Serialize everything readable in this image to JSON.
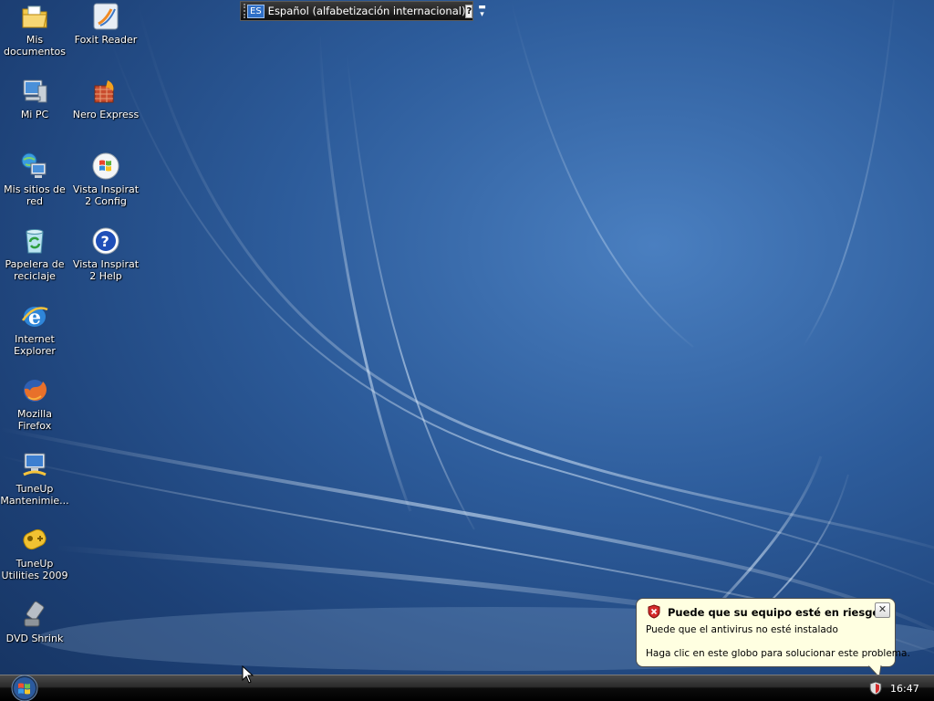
{
  "desktop": {
    "icons": [
      {
        "label": "Mis documentos",
        "icon": "folder-documents-icon"
      },
      {
        "label": "Foxit Reader",
        "icon": "pdf-reader-icon"
      },
      {
        "label": "Mi PC",
        "icon": "computer-icon"
      },
      {
        "label": "Nero Express",
        "icon": "disc-burner-icon"
      },
      {
        "label": "Mis sitios de red",
        "icon": "network-icon"
      },
      {
        "label": "Vista Inspirat 2 Config",
        "icon": "windows-logo-icon"
      },
      {
        "label": "Papelera de reciclaje",
        "icon": "recycle-bin-icon"
      },
      {
        "label": "Vista Inspirat 2 Help",
        "icon": "help-icon"
      },
      {
        "label": "Internet Explorer",
        "icon": "internet-explorer-icon"
      },
      {
        "label": "Mozilla Firefox",
        "icon": "firefox-icon"
      },
      {
        "label": "TuneUp Mantenimie...",
        "icon": "tuneup-maintenance-icon"
      },
      {
        "label": "TuneUp Utilities 2009",
        "icon": "tuneup-utilities-icon"
      },
      {
        "label": "DVD Shrink",
        "icon": "dvd-shrink-icon"
      }
    ]
  },
  "language_bar": {
    "code": "ES",
    "name": "Español (alfabetización internacional)",
    "help_glyph": "?"
  },
  "balloon": {
    "title": "Puede que su equipo esté en riesgo",
    "line1": "Puede que el antivirus no esté instalado",
    "line2": "Haga clic en este globo para solucionar este problema.",
    "close_glyph": "✕"
  },
  "taskbar": {
    "clock": "16:47"
  },
  "colors": {
    "balloon_bg": "#ffffe1",
    "security_red": "#d42b2b",
    "wallpaper_blue": "#2d5c9b"
  }
}
